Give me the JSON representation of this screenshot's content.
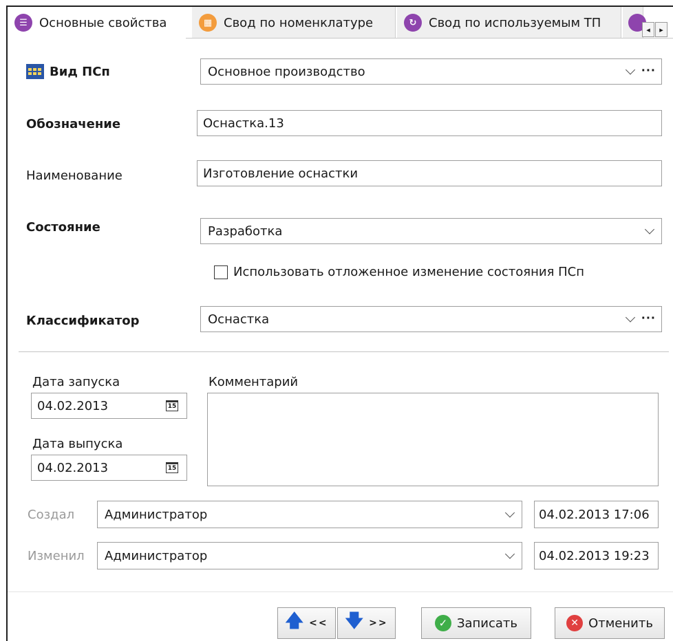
{
  "tabs": [
    {
      "label": "Основные свойства",
      "icon": "list-icon",
      "color": "#8e44ad",
      "active": true
    },
    {
      "label": "Свод по номенклатуре",
      "icon": "table-icon",
      "color": "#f39c3d",
      "active": false
    },
    {
      "label": "Свод по используемым ТП",
      "icon": "refresh-icon",
      "color": "#8e44ad",
      "active": false
    }
  ],
  "tab_scroll": {
    "left": "◂",
    "right": "▸"
  },
  "form": {
    "vid_label": "Вид ПСп",
    "vid_value": "Основное производство",
    "designation_label": "Обозначение",
    "designation_value": "Оснастка.13",
    "name_label": "Наименование",
    "name_value": "Изготовление оснастки",
    "state_label": "Состояние",
    "state_value": "Разработка",
    "deferred_label": "Использовать отложенное изменение состояния ПСп",
    "classifier_label": "Классификатор",
    "classifier_value": "Оснастка",
    "launch_date_label": "Дата запуска",
    "launch_date_value": "04.02.2013",
    "release_date_label": "Дата выпуска",
    "release_date_value": "04.02.2013",
    "comment_label": "Комментарий",
    "comment_value": "",
    "created_label": "Создал",
    "created_by": "Администратор",
    "created_at": "04.02.2013 17:06",
    "modified_label": "Изменил",
    "modified_by": "Администратор",
    "modified_at": "04.02.2013 19:23",
    "calendar_icon_text": "15",
    "dots": "···"
  },
  "buttons": {
    "prev_label": "<<",
    "next_label": ">>",
    "save_label": "Записать",
    "cancel_label": "Отменить"
  },
  "colors": {
    "accent": "#1f5fd0",
    "ok": "#3fae49",
    "cancel": "#e04040"
  }
}
